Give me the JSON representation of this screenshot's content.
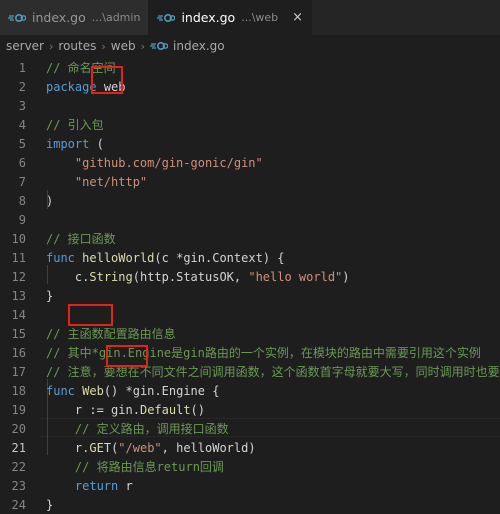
{
  "tabs": [
    {
      "name": "index.go",
      "desc": "...\\admin",
      "active": false
    },
    {
      "name": "index.go",
      "desc": "...\\web",
      "active": true,
      "close": "×"
    }
  ],
  "breadcrumb": [
    "server",
    "routes",
    "web",
    "index.go"
  ],
  "editor": {
    "current_line": 21,
    "lines": [
      {
        "n": "1",
        "t": "// 命名空间"
      },
      {
        "n": "2",
        "t": "package web"
      },
      {
        "n": "3",
        "t": ""
      },
      {
        "n": "4",
        "t": "// 引入包"
      },
      {
        "n": "5",
        "t": "import ("
      },
      {
        "n": "6",
        "t": "    \"github.com/gin-gonic/gin\""
      },
      {
        "n": "7",
        "t": "    \"net/http\""
      },
      {
        "n": "8",
        "t": ")"
      },
      {
        "n": "9",
        "t": ""
      },
      {
        "n": "10",
        "t": "// 接口函数"
      },
      {
        "n": "11",
        "t": "func helloWorld(c *gin.Context) {"
      },
      {
        "n": "12",
        "t": "    c.String(http.StatusOK, \"hello world\")"
      },
      {
        "n": "13",
        "t": "}"
      },
      {
        "n": "14",
        "t": ""
      },
      {
        "n": "15",
        "t": "// 主函数配置路由信息"
      },
      {
        "n": "16",
        "t": "// 其中*gin.Engine是gin路由的一个实例，在模块的路由中需要引用这个实例"
      },
      {
        "n": "17",
        "t": "// 注意，要想在不同文件之间调用函数，这个函数首字母就要大写，同时调用时也要大写"
      },
      {
        "n": "18",
        "t": "func Web() *gin.Engine {"
      },
      {
        "n": "19",
        "t": "    r := gin.Default()"
      },
      {
        "n": "20",
        "t": "    // 定义路由，调用接口函数"
      },
      {
        "n": "21",
        "t": "    r.GET(\"/web\", helloWorld)"
      },
      {
        "n": "22",
        "t": "    // 将路由信息return回调"
      },
      {
        "n": "23",
        "t": "    return r"
      },
      {
        "n": "24",
        "t": "}"
      }
    ]
  },
  "colors": {
    "keyword": "#569cd6",
    "string": "#ce9178",
    "comment": "#6a9955",
    "function": "#dcdcaa",
    "highlight_box": "#e2231a"
  },
  "icons": {
    "file": "go-file-icon",
    "close": "close-icon"
  }
}
